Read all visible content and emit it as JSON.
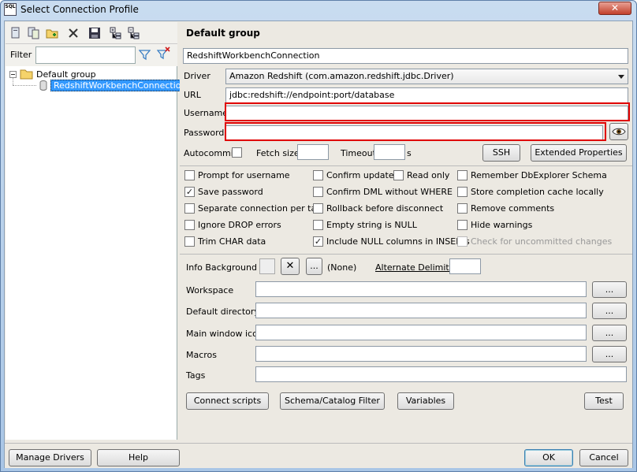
{
  "window": {
    "title": "Select Connection Profile",
    "app_icon_text": "SQL",
    "close_glyph": "✕"
  },
  "toolbar": {
    "icons": [
      "new-profile-icon",
      "copy-profile-icon",
      "new-group-icon",
      "delete-icon",
      "save-icon",
      "expand-icon",
      "collapse-icon"
    ]
  },
  "filter": {
    "label": "Filter",
    "value": ""
  },
  "tree": {
    "group": "Default group",
    "profile": "RedshiftWorkbenchConnection"
  },
  "profile": {
    "group_header": "Default group",
    "name": "RedshiftWorkbenchConnection",
    "driver_label": "Driver",
    "driver_value": "Amazon Redshift (com.amazon.redshift.jdbc.Driver)",
    "url_label": "URL",
    "url_value": "jdbc:redshift://endpoint:port/database",
    "username_label": "Username",
    "username_value": "",
    "password_label": "Password",
    "password_value": "",
    "autocommit_label": "Autocommit",
    "fetch_size_label": "Fetch size",
    "fetch_size_value": "",
    "timeout_label": "Timeout",
    "timeout_value": "",
    "timeout_unit": "s",
    "ssh_label": "SSH",
    "ext_props_label": "Extended Properties"
  },
  "options": [
    {
      "label": "Prompt for username",
      "checked": false
    },
    {
      "label": "Confirm updates",
      "checked": false
    },
    {
      "label": "Read only",
      "checked": false
    },
    {
      "label": "Remember DbExplorer Schema",
      "checked": false
    },
    {
      "label": "Save password",
      "checked": true
    },
    {
      "label": "Confirm DML without WHERE",
      "checked": false
    },
    {
      "label": "Store completion cache locally",
      "checked": false
    },
    {
      "label": "Separate connection per tab",
      "checked": false
    },
    {
      "label": "Rollback before disconnect",
      "checked": false
    },
    {
      "label": "Remove comments",
      "checked": false
    },
    {
      "label": "Ignore DROP errors",
      "checked": false
    },
    {
      "label": "Empty string is NULL",
      "checked": false
    },
    {
      "label": "Hide warnings",
      "checked": false
    },
    {
      "label": "Trim CHAR data",
      "checked": false
    },
    {
      "label": "Include NULL columns in INSERTs",
      "checked": true
    },
    {
      "label": "Check for uncommitted changes",
      "checked": false
    }
  ],
  "extra": {
    "info_bg_label": "Info Background",
    "clear_glyph": "✕",
    "ellipsis": "...",
    "none_label": "(None)",
    "alt_delim_label": "Alternate Delimiter",
    "alt_delim_value": "",
    "workspace_label": "Workspace",
    "workspace_value": "",
    "default_dir_label": "Default directory",
    "default_dir_value": "",
    "main_icon_label": "Main window icon",
    "main_icon_value": "",
    "macros_label": "Macros",
    "macros_value": "",
    "tags_label": "Tags",
    "tags_value": ""
  },
  "actions": {
    "connect_scripts": "Connect scripts",
    "schema_filter": "Schema/Catalog Filter",
    "variables": "Variables",
    "test": "Test"
  },
  "footer": {
    "manage_drivers": "Manage Drivers",
    "help": "Help",
    "ok": "OK",
    "cancel": "Cancel"
  },
  "colors": {
    "highlight": "#e00000",
    "selection": "#3399ff"
  }
}
